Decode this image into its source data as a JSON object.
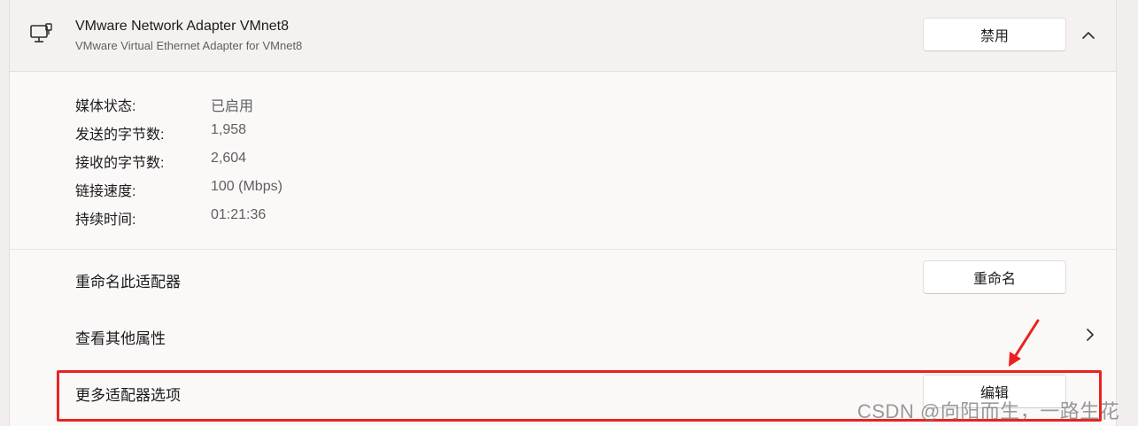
{
  "adapter": {
    "name": "VMware Network Adapter VMnet8",
    "description": "VMware Virtual Ethernet Adapter for VMnet8",
    "icon": "network-adapter-icon",
    "disable_label": "禁用"
  },
  "details": [
    {
      "label": "媒体状态:",
      "value": "已启用"
    },
    {
      "label": "发送的字节数:",
      "value": "1,958"
    },
    {
      "label": "接收的字节数:",
      "value": "2,604"
    },
    {
      "label": "链接速度:",
      "value": "100 (Mbps)"
    },
    {
      "label": "持续时间:",
      "value": "01:21:36"
    }
  ],
  "rename": {
    "label": "重命名此适配器",
    "button": "重命名"
  },
  "more_properties": {
    "label": "查看其他属性"
  },
  "more_options": {
    "label": "更多适配器选项",
    "button": "编辑"
  },
  "annotation": {
    "color": "#e8231f"
  },
  "watermark": "CSDN @向阳而生，一路生花"
}
